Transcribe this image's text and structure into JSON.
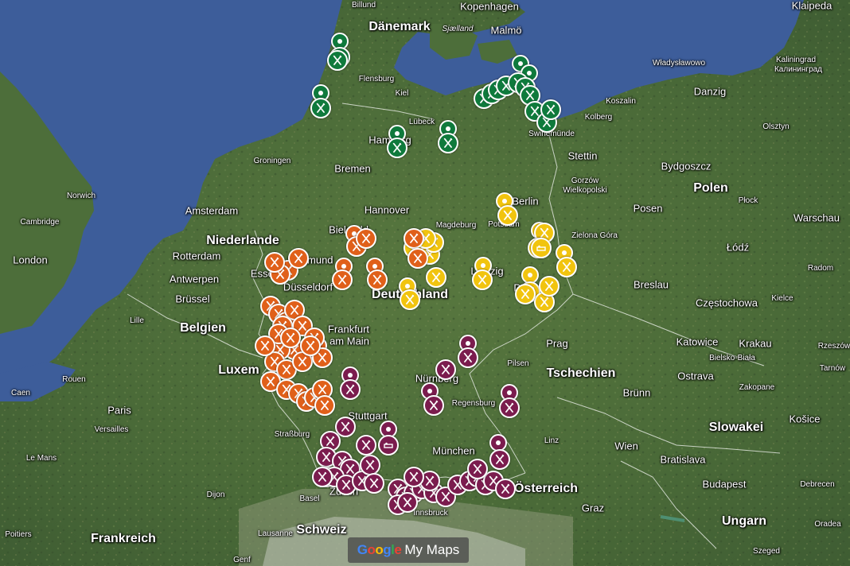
{
  "map": {
    "attribution_google": "Google",
    "attribution_product": "My Maps",
    "colors": {
      "water": "#3d5d9a",
      "land": "#4b6e3a",
      "north_markers": "#0f7a3c",
      "east_markers": "#f1c40f",
      "west_markers": "#e0601a",
      "south_markers": "#7b1c4e"
    },
    "icons": {
      "restaurant": "fork-knife-icon",
      "hotel": "bed-icon",
      "pin": "map-pin-icon"
    }
  },
  "labels": {
    "countries": [
      "Dänemark",
      "Niederlande",
      "Belgien",
      "Luxem",
      "Deutschland",
      "Tschechien",
      "Polen",
      "Slowakei",
      "Österreich",
      "Schweiz",
      "Frankreich",
      "Ungarn"
    ],
    "cities": [
      "Kopenhagen",
      "Malmö",
      "Billund",
      "Klaipėda",
      "Flensburg",
      "Kiel",
      "Lübeck",
      "Hamburg",
      "Swinemünde",
      "Władysławowo",
      "Kaliningrad",
      "Калининград",
      "Koszalin",
      "Kolberg",
      "Danzig",
      "Olsztyn",
      "Stettin",
      "Bydgoszcz",
      "Gorzów Wielkopolski",
      "Groningen",
      "Bremen",
      "Hannover",
      "Berlin",
      "Potsdam",
      "Magdeburg",
      "Bielefeld",
      "Amsterdam",
      "Norwich",
      "Cambridge",
      "London",
      "Rotterdam",
      "Dortmund",
      "Essen",
      "Düsseldorf",
      "Antwerpen",
      "Brüssel",
      "Lille",
      "Frankfurt am Main",
      "Leipzig",
      "Dresden",
      "Posen",
      "Warschau",
      "Płock",
      "Łódź",
      "Radom",
      "Zielona Góra",
      "Breslau",
      "Częstochowa",
      "Kielce",
      "Katowice",
      "Krakau",
      "Rzeszów",
      "Tarnów",
      "Bielsko-Biała",
      "Ostrava",
      "Zakopane",
      "Prag",
      "Pilsen",
      "Nürnberg",
      "Regensburg",
      "Brünn",
      "Košice",
      "Rouen",
      "Caen",
      "Paris",
      "Versailles",
      "Stuttgart",
      "Straßburg",
      "München",
      "Linz",
      "Wien",
      "Bratislava",
      "Budapest",
      "Debrecen",
      "Le Mans",
      "Dijon",
      "Basel",
      "Zürich",
      "Innsbruck",
      "Graz",
      "Oradea",
      "Poitiers",
      "Lausanne",
      "Genf",
      "Szeged",
      "Sjælland",
      "Ulm"
    ],
    "city_displayed": [
      "Kopenhagen",
      "Malmö",
      "Billund",
      "Klaipeda",
      "Flensburg",
      "Kiel",
      "Lübeck",
      "Hamburg",
      "Swinemünde",
      "Władysławowo",
      "Kaliningrad",
      "Калининград",
      "Koszalin",
      "Kolberg",
      "Danzig",
      "Olsztyn",
      "Stettin",
      "Bydgoszcz",
      "Gorzów",
      "Wielkopolski",
      "Groningen",
      "Bremen",
      "Hannover",
      "Berlin",
      "Potsdam",
      "Magdeburg",
      "Bielefeld",
      "Amsterdam",
      "Norwich",
      "Cambridge",
      "London",
      "Rotterdam",
      "Dortmund",
      "Essen",
      "Düsseldorf",
      "Antwerpen",
      "Brüssel",
      "Lille",
      "Frankfurt",
      "am Main",
      "Leipzig",
      "Dresden",
      "Posen",
      "Warschau",
      "Płock",
      "Łódź",
      "Radom",
      "Zielona Góra",
      "Breslau",
      "Częstochowa",
      "Kielce",
      "Katowice",
      "Krakau",
      "Rzeszów",
      "Tarnów",
      "Bielsko-Biała",
      "Ostrava",
      "Zakopane",
      "Prag",
      "Pilsen",
      "Nürnberg",
      "Regensburg",
      "Brünn",
      "Košice",
      "Rouen",
      "Caen",
      "Paris",
      "Versailles",
      "Stuttgart",
      "Straßburg",
      "München",
      "Linz",
      "Wien",
      "Bratislava",
      "Budapest",
      "Debrecen",
      "Le Mans",
      "Dijon",
      "Basel",
      "Zürich",
      "Innsbruck",
      "Graz",
      "Oradea",
      "Poitiers",
      "Lausanne",
      "Genf",
      "Szeged",
      "Sjælland",
      "Ulm"
    ]
  }
}
